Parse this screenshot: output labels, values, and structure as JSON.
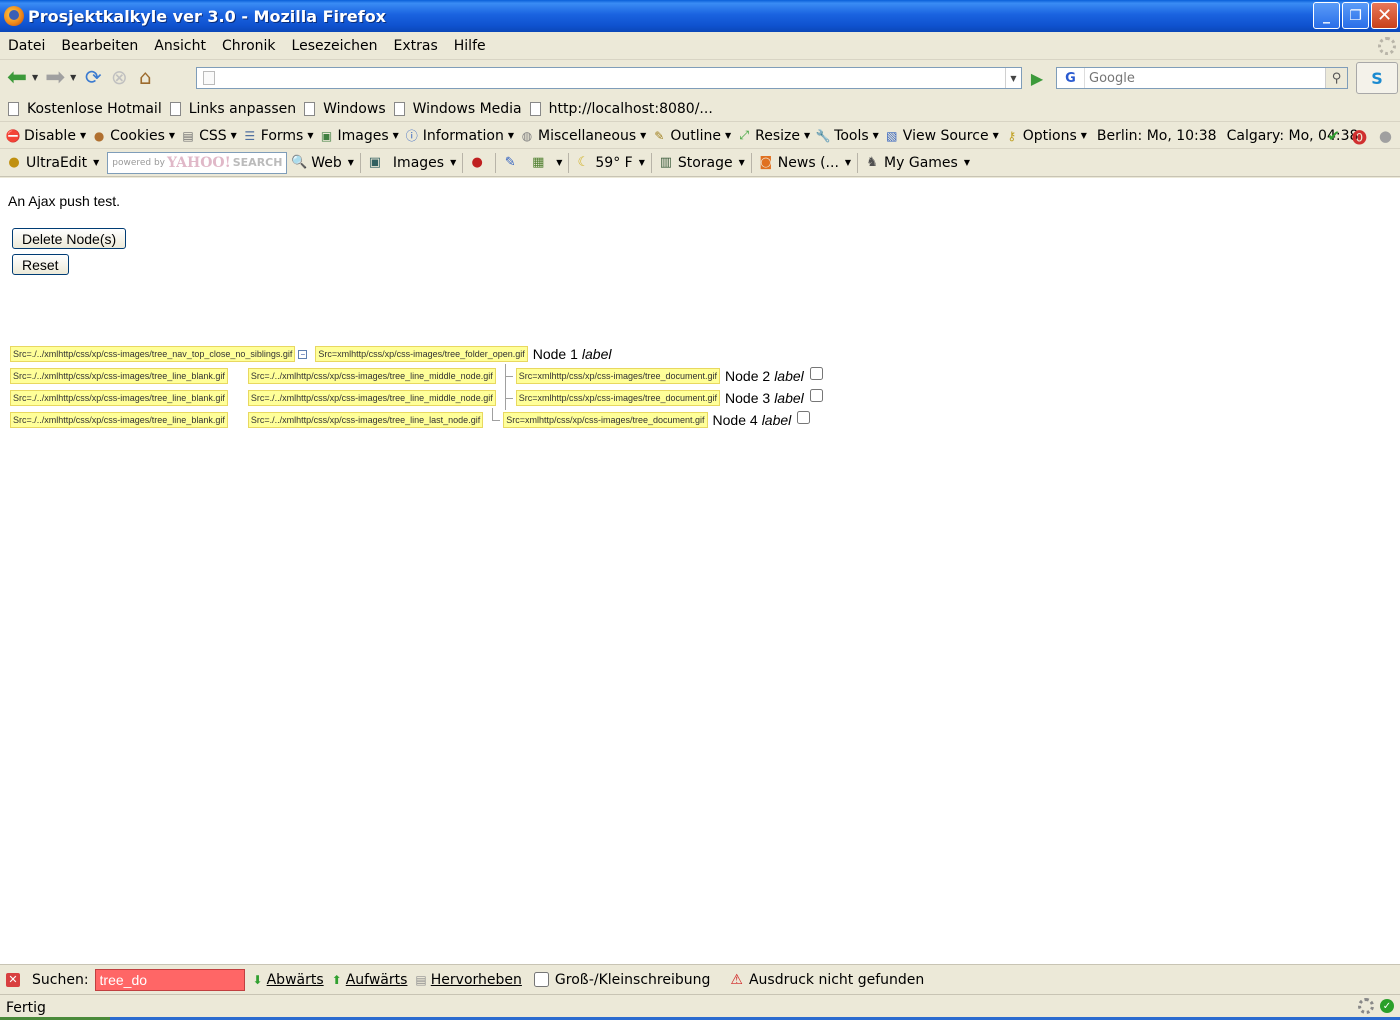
{
  "window": {
    "title": "Prosjektkalkyle ver 3.0 - Mozilla Firefox"
  },
  "menu": [
    "Datei",
    "Bearbeiten",
    "Ansicht",
    "Chronik",
    "Lesezeichen",
    "Extras",
    "Hilfe"
  ],
  "nav": {
    "url": "",
    "search_placeholder": "Google"
  },
  "bookmarks": [
    "Kostenlose Hotmail",
    "Links anpassen",
    "Windows",
    "Windows Media",
    "http://localhost:8080/..."
  ],
  "devbar": {
    "items": [
      "Disable",
      "Cookies",
      "CSS",
      "Forms",
      "Images",
      "Information",
      "Miscellaneous",
      "Outline",
      "Resize",
      "Tools",
      "View Source",
      "Options"
    ],
    "clock_berlin": "Berlin: Mo, 10:38",
    "clock_calgary": "Calgary: Mo, 04:38"
  },
  "yahoobar": {
    "ultraedit": "UltraEdit",
    "search_powered": "powered by",
    "search_brand": "YAHOO!",
    "search_suffix": "SEARCH",
    "web": "Web",
    "images": "Images",
    "weather": "59° F",
    "storage": "Storage",
    "news": "News (...",
    "games": "My Games"
  },
  "content": {
    "intro": "An Ajax push test.",
    "delete_button": "Delete Node(s)",
    "reset_button": "Reset",
    "tree": {
      "row1": {
        "img1": "Src=./../xmlhttp/css/xp/css-images/tree_nav_top_close_no_siblings.gif",
        "img2": "Src=xmlhttp/css/xp/css-images/tree_folder_open.gif",
        "label": "Node 1",
        "italic": "label"
      },
      "row2": {
        "img1": "Src=./../xmlhttp/css/xp/css-images/tree_line_blank.gif",
        "img2": "Src=./../xmlhttp/css/xp/css-images/tree_line_middle_node.gif",
        "img3": "Src=xmlhttp/css/xp/css-images/tree_document.gif",
        "label": "Node 2",
        "italic": "label"
      },
      "row3": {
        "img1": "Src=./../xmlhttp/css/xp/css-images/tree_line_blank.gif",
        "img2": "Src=./../xmlhttp/css/xp/css-images/tree_line_middle_node.gif",
        "img3": "Src=xmlhttp/css/xp/css-images/tree_document.gif",
        "label": "Node 3",
        "italic": "label"
      },
      "row4": {
        "img1": "Src=./../xmlhttp/css/xp/css-images/tree_line_blank.gif",
        "img2": "Src=./../xmlhttp/css/xp/css-images/tree_line_last_node.gif",
        "img3": "Src=xmlhttp/css/xp/css-images/tree_document.gif",
        "label": "Node 4",
        "italic": "label"
      }
    }
  },
  "findbar": {
    "label": "Suchen:",
    "value": "tree_do",
    "down": "Abwärts",
    "up": "Aufwärts",
    "highlight": "Hervorheben",
    "match_case": "Groß-/Kleinschreibung",
    "status": "Ausdruck nicht gefunden"
  },
  "statusbar": {
    "text": "Fertig"
  },
  "colors": {
    "title_blue": "#0f52cf",
    "tag_yellow": "#ffff99",
    "find_error": "#ff6666"
  }
}
